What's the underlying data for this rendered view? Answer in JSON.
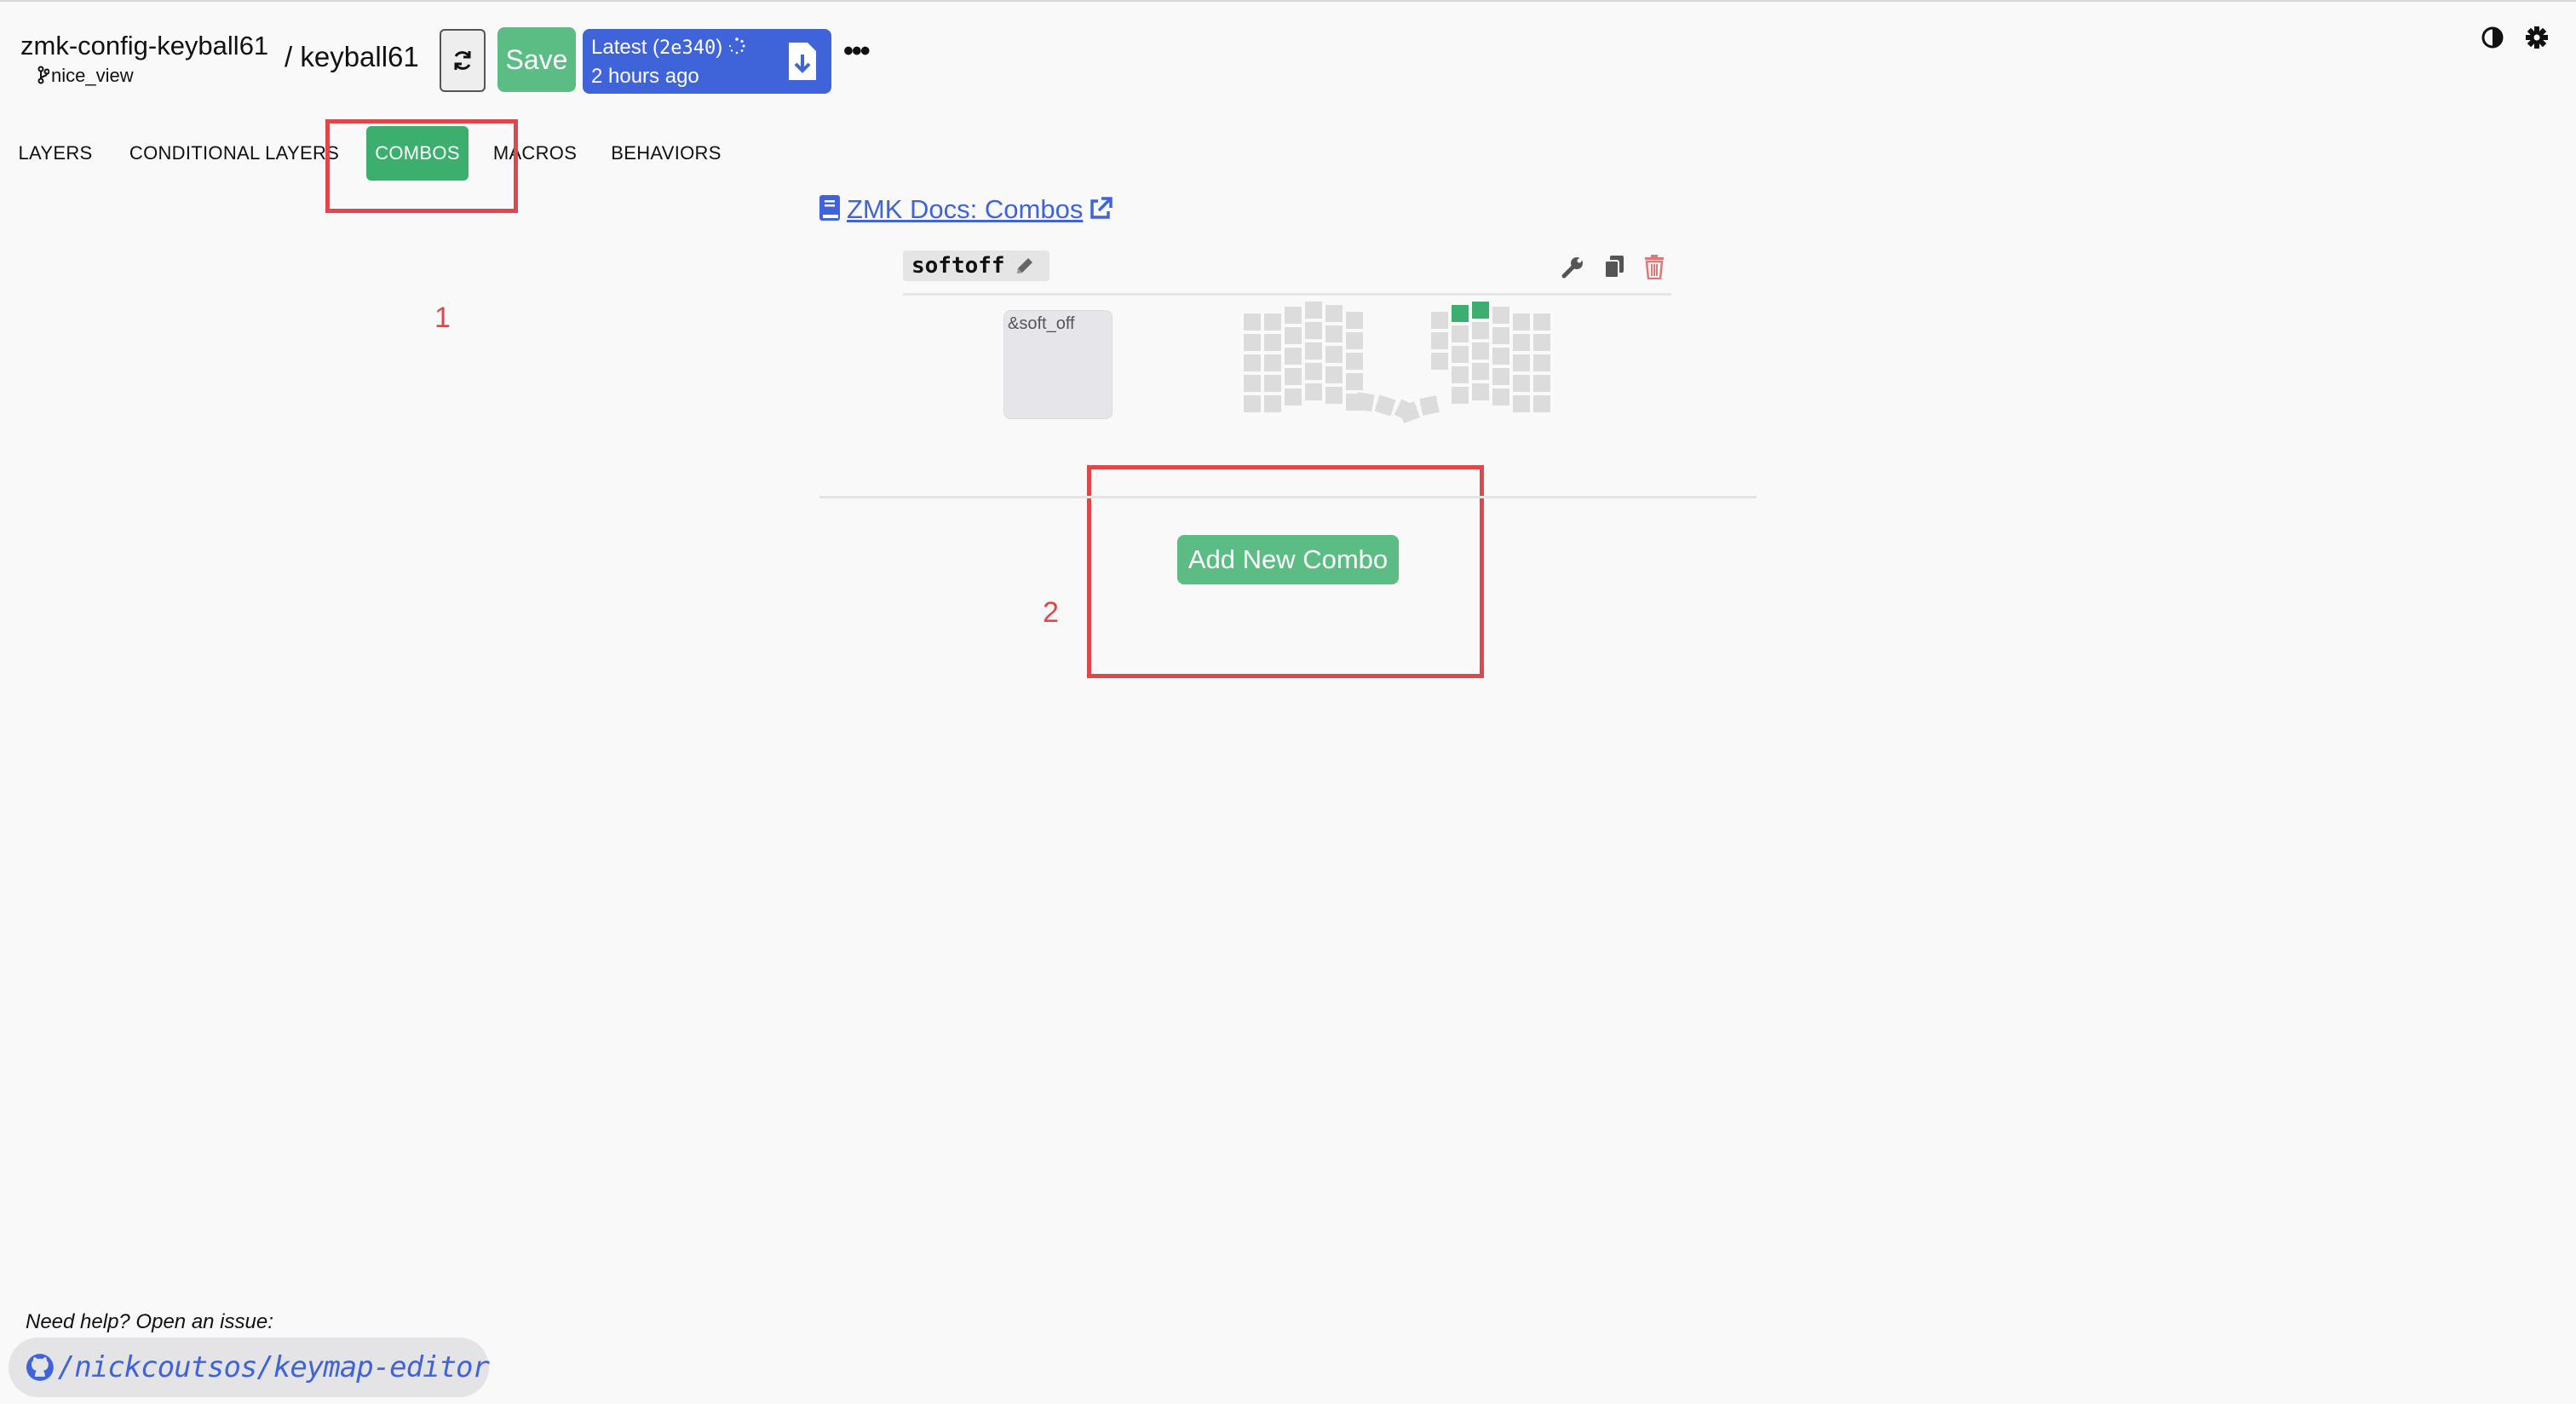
{
  "header": {
    "repo_name": "zmk-config-keyball61",
    "branch": "nice_view",
    "keyboard_name": "/ keyball61",
    "save_label": "Save",
    "release": {
      "label": "Latest (",
      "commit": "2e340",
      "close": ")",
      "time": "2 hours ago"
    },
    "more_label": "•••"
  },
  "tabs": [
    {
      "label": "LAYERS",
      "active": false
    },
    {
      "label": "CONDITIONAL  LAYERS",
      "active": false
    },
    {
      "label": "COMBOS",
      "active": true
    },
    {
      "label": "MACROS",
      "active": false
    },
    {
      "label": "BEHAVIORS",
      "active": false
    }
  ],
  "annotations": [
    "1",
    "2"
  ],
  "annotation_color": "#e0464a",
  "docs_link": "ZMK Docs: Combos",
  "combos": [
    {
      "name": "softoff",
      "binding": "&soft_off"
    }
  ],
  "add_combo_label": "Add New Combo",
  "footer": {
    "help_text": "Need help? Open an issue:",
    "repo_link": "/nickcoutsos/keymap-editor"
  },
  "colors": {
    "accent_green": "#5cbd84",
    "tab_active_green": "#3cae6d",
    "release_blue": "#3f63d8",
    "link_blue": "#3f63d8",
    "delete_red": "#e0787a"
  }
}
